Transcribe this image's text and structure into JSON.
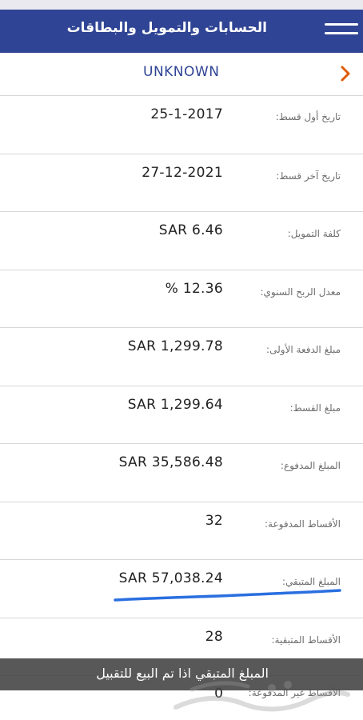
{
  "header": {
    "title": "الحسابات والتمويل والبطاقات",
    "menu_icon": "hamburger-menu-icon",
    "background_color": "#2f4494"
  },
  "account": {
    "name": "UNKNOWN",
    "chevron_icon": "chevron-right-icon",
    "accent_color": "#e05a00"
  },
  "details": [
    {
      "label": "تاريخ أول قسط:",
      "value": "25-1-2017"
    },
    {
      "label": "تاريخ آخر قسط:",
      "value": "27-12-2021"
    },
    {
      "label": "كلفة التمويل:",
      "value": "SAR 6.46"
    },
    {
      "label": "معدل الربح السنوي:",
      "value": "% 12.36"
    },
    {
      "label": "مبلغ الدفعة الأولى:",
      "value": "SAR 1,299.78"
    },
    {
      "label": "مبلغ القسط:",
      "value": "SAR 1,299.64"
    },
    {
      "label": "المبلغ المدفوع:",
      "value": "SAR 35,586.48"
    },
    {
      "label": "الأقساط المدفوعة:",
      "value": "32"
    },
    {
      "label": "المبلغ المتبقي:",
      "value": "SAR 57,038.24"
    },
    {
      "label": "الأقساط المتبقية:",
      "value": "28"
    }
  ],
  "overlay": {
    "caption": "المبلغ المتبقي اذا تم البيع للتقبيل"
  },
  "last_row": {
    "label": "الأقساط غير المدفوعة:",
    "value": "0"
  }
}
